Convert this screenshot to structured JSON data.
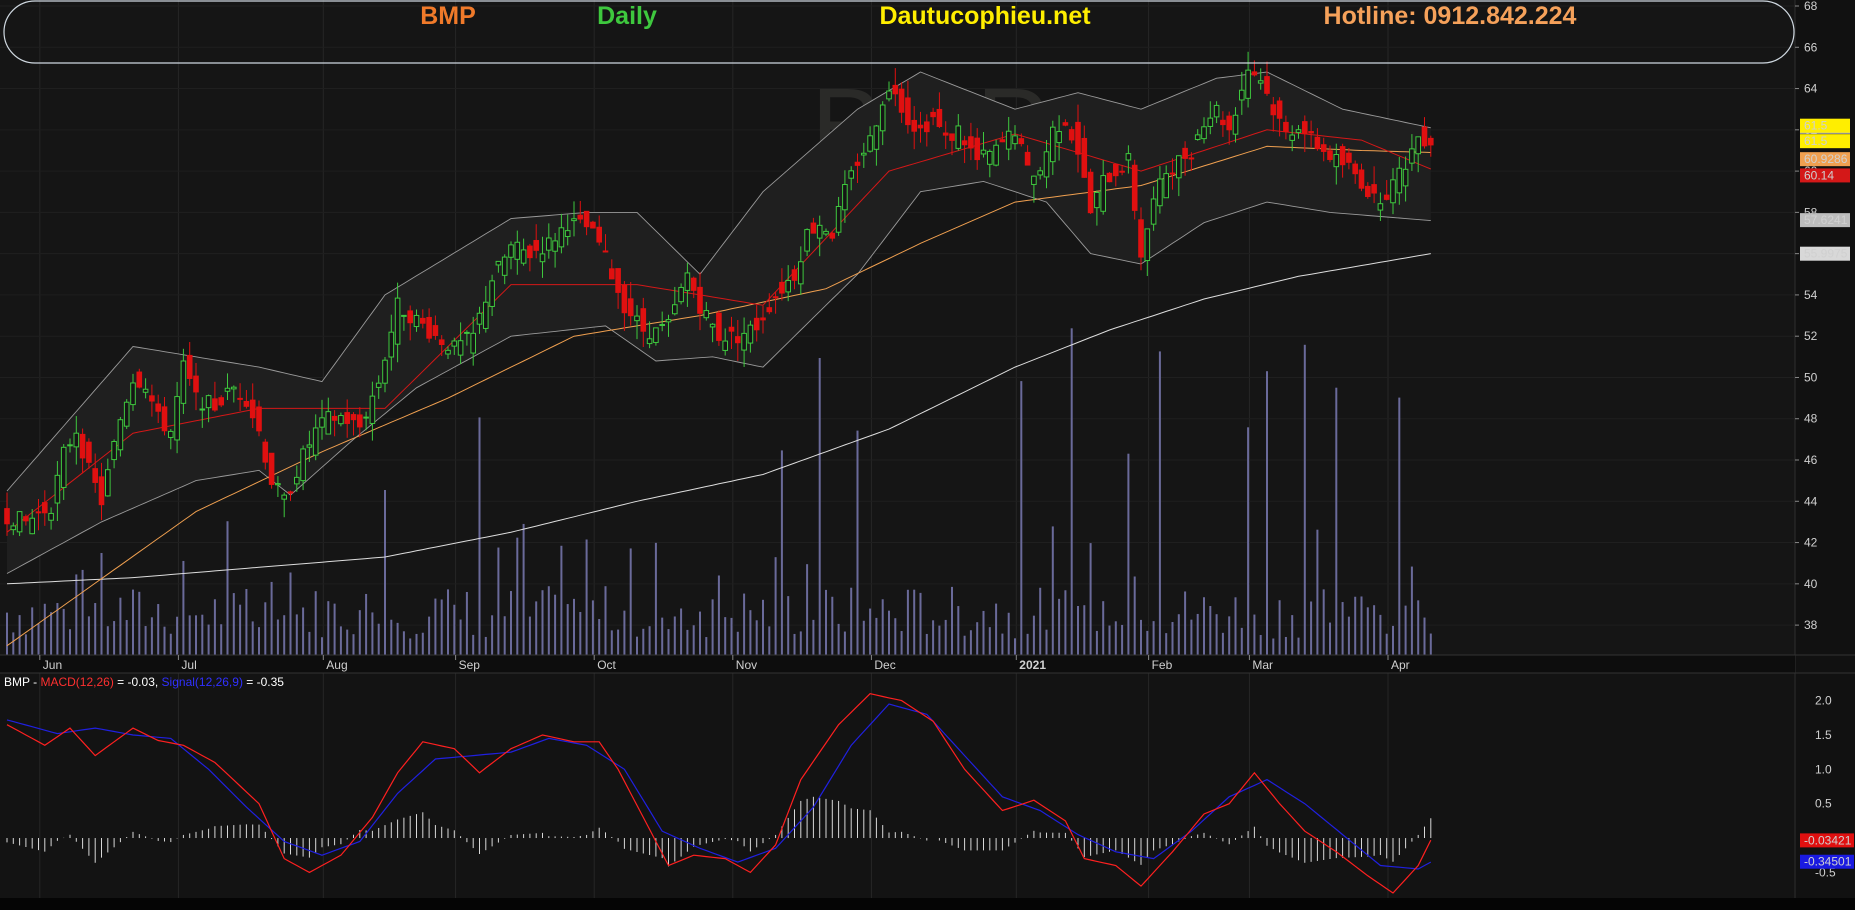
{
  "header": {
    "ticker": "BMP",
    "period": "Daily",
    "site": "Dautucophieu.net",
    "hotline": "Hotline: 0912.842.224",
    "watermark": "BMP"
  },
  "colors": {
    "background": "#151515",
    "up": "#3ec83e",
    "down": "#e01010",
    "ma_red": "#d41818",
    "ma_orange": "#f0a050",
    "ma_white": "#dddddd",
    "bands": "#9a9a9a",
    "volume": "#6a6a9a",
    "macd": "#ff2020",
    "signal": "#2020e0",
    "ticker_color": "#f07a2a",
    "period_color": "#3ec83e",
    "site_color": "#ffee00",
    "hotline_color": "#f5a15a"
  },
  "chart_data": {
    "type": "candlestick",
    "price_axis": {
      "ylim": [
        36.6,
        68
      ],
      "ticks": [
        "38",
        "40",
        "42",
        "44",
        "46",
        "48",
        "50",
        "52",
        "54",
        "56",
        "58",
        "60",
        "62",
        "64",
        "66",
        "68"
      ]
    },
    "x_labels": [
      {
        "label": "Jun",
        "bar": 6
      },
      {
        "label": "Jul",
        "bar": 28
      },
      {
        "label": "Aug",
        "bar": 51
      },
      {
        "label": "Sep",
        "bar": 72
      },
      {
        "label": "Oct",
        "bar": 94
      },
      {
        "label": "Nov",
        "bar": 116
      },
      {
        "label": "Dec",
        "bar": 138
      },
      {
        "label": "2021",
        "bar": 161
      },
      {
        "label": "Feb",
        "bar": 182
      },
      {
        "label": "Mar",
        "bar": 198
      },
      {
        "label": "Apr",
        "bar": 220
      }
    ],
    "price_anchors": [
      [
        0,
        43.3
      ],
      [
        3,
        43.0
      ],
      [
        7,
        43.8
      ],
      [
        9,
        46.3
      ],
      [
        11,
        47.5
      ],
      [
        13,
        45.5
      ],
      [
        15,
        44.0
      ],
      [
        18,
        48.0
      ],
      [
        20,
        50.0
      ],
      [
        22,
        49.7
      ],
      [
        24,
        48.0
      ],
      [
        26,
        47.4
      ],
      [
        28,
        50.5
      ],
      [
        30,
        49.0
      ],
      [
        33,
        48.6
      ],
      [
        36,
        49.5
      ],
      [
        38,
        49.0
      ],
      [
        40,
        47.4
      ],
      [
        42,
        45.0
      ],
      [
        44,
        44.0
      ],
      [
        47,
        46.2
      ],
      [
        49,
        47.4
      ],
      [
        51,
        48.0
      ],
      [
        53,
        48.1
      ],
      [
        56,
        47.6
      ],
      [
        59,
        49.8
      ],
      [
        62,
        53.5
      ],
      [
        65,
        52.8
      ],
      [
        68,
        52.0
      ],
      [
        71,
        51.4
      ],
      [
        74,
        52.0
      ],
      [
        77,
        54.8
      ],
      [
        80,
        56.3
      ],
      [
        83,
        56.0
      ],
      [
        86,
        56.5
      ],
      [
        89,
        57.5
      ],
      [
        92,
        57.3
      ],
      [
        94,
        56.5
      ],
      [
        96,
        55.0
      ],
      [
        98,
        53.5
      ],
      [
        101,
        52.3
      ],
      [
        103,
        52.2
      ],
      [
        105,
        52.5
      ],
      [
        108,
        55.0
      ],
      [
        110,
        53.5
      ],
      [
        113,
        52.0
      ],
      [
        116,
        52.0
      ],
      [
        119,
        52.5
      ],
      [
        122,
        54.0
      ],
      [
        125,
        55.0
      ],
      [
        127,
        57.0
      ],
      [
        129,
        57.5
      ],
      [
        131,
        57.0
      ],
      [
        133,
        59.0
      ],
      [
        135,
        60.5
      ],
      [
        137,
        61.5
      ],
      [
        139,
        63.5
      ],
      [
        141,
        64.0
      ],
      [
        143,
        62.5
      ],
      [
        145,
        62.0
      ],
      [
        147,
        62.6
      ],
      [
        149,
        61.5
      ],
      [
        151,
        62.0
      ],
      [
        154,
        60.5
      ],
      [
        157,
        61.0
      ],
      [
        160,
        62.0
      ],
      [
        162,
        60.0
      ],
      [
        164,
        60.0
      ],
      [
        166,
        62.0
      ],
      [
        168,
        62.5
      ],
      [
        170,
        61.0
      ],
      [
        172,
        58.0
      ],
      [
        174,
        59.5
      ],
      [
        176,
        60.0
      ],
      [
        178,
        60.5
      ],
      [
        180,
        56.0
      ],
      [
        182,
        58.5
      ],
      [
        184,
        60.0
      ],
      [
        186,
        60.5
      ],
      [
        188,
        61.0
      ],
      [
        190,
        62.5
      ],
      [
        192,
        63.0
      ],
      [
        194,
        62.0
      ],
      [
        197,
        65.0
      ],
      [
        199,
        64.5
      ],
      [
        201,
        63.0
      ],
      [
        203,
        61.8
      ],
      [
        205,
        62.3
      ],
      [
        207,
        61.5
      ],
      [
        209,
        61.0
      ],
      [
        211,
        60.5
      ],
      [
        213,
        60.2
      ],
      [
        215,
        59.5
      ],
      [
        217,
        58.6
      ],
      [
        219,
        59.0
      ],
      [
        221,
        59.8
      ],
      [
        223,
        61.0
      ],
      [
        224,
        61.7
      ],
      [
        226,
        61.5
      ]
    ],
    "ma20_anchors": [
      [
        0,
        42.5
      ],
      [
        20,
        47.3
      ],
      [
        40,
        48.5
      ],
      [
        60,
        48.5
      ],
      [
        80,
        54.5
      ],
      [
        100,
        54.5
      ],
      [
        120,
        53.5
      ],
      [
        140,
        60.0
      ],
      [
        160,
        61.8
      ],
      [
        180,
        60.0
      ],
      [
        200,
        62.0
      ],
      [
        215,
        61.5
      ],
      [
        226,
        60.1
      ]
    ],
    "ma50_anchors": [
      [
        0,
        37.0
      ],
      [
        30,
        43.5
      ],
      [
        50,
        46.4
      ],
      [
        70,
        49.0
      ],
      [
        90,
        52.0
      ],
      [
        110,
        53.0
      ],
      [
        130,
        54.3
      ],
      [
        145,
        56.5
      ],
      [
        160,
        58.5
      ],
      [
        180,
        59.3
      ],
      [
        200,
        61.2
      ],
      [
        215,
        61.0
      ],
      [
        226,
        60.9
      ]
    ],
    "ma200_anchors": [
      [
        0,
        40.0
      ],
      [
        20,
        40.3
      ],
      [
        40,
        40.8
      ],
      [
        60,
        41.3
      ],
      [
        80,
        42.5
      ],
      [
        100,
        44.0
      ],
      [
        120,
        45.3
      ],
      [
        140,
        47.5
      ],
      [
        160,
        50.5
      ],
      [
        175,
        52.3
      ],
      [
        190,
        53.8
      ],
      [
        205,
        54.9
      ],
      [
        226,
        56.0
      ]
    ],
    "band_upper_anchors": [
      [
        0,
        44.5
      ],
      [
        20,
        51.5
      ],
      [
        40,
        50.5
      ],
      [
        50,
        49.8
      ],
      [
        60,
        54.0
      ],
      [
        80,
        57.7
      ],
      [
        92,
        58.0
      ],
      [
        100,
        58.0
      ],
      [
        110,
        55.0
      ],
      [
        120,
        59.0
      ],
      [
        135,
        63.0
      ],
      [
        145,
        64.8
      ],
      [
        160,
        63.0
      ],
      [
        170,
        63.8
      ],
      [
        180,
        63.0
      ],
      [
        192,
        64.5
      ],
      [
        200,
        64.8
      ],
      [
        212,
        63.0
      ],
      [
        226,
        62.1
      ]
    ],
    "band_lower_anchors": [
      [
        0,
        40.5
      ],
      [
        15,
        43.0
      ],
      [
        30,
        45.0
      ],
      [
        40,
        45.5
      ],
      [
        45,
        44.3
      ],
      [
        55,
        47.0
      ],
      [
        65,
        49.5
      ],
      [
        80,
        52.0
      ],
      [
        95,
        52.5
      ],
      [
        103,
        50.8
      ],
      [
        112,
        51.0
      ],
      [
        120,
        50.5
      ],
      [
        135,
        55.0
      ],
      [
        145,
        59.0
      ],
      [
        155,
        59.5
      ],
      [
        165,
        58.5
      ],
      [
        172,
        56.0
      ],
      [
        180,
        55.5
      ],
      [
        190,
        57.5
      ],
      [
        200,
        58.5
      ],
      [
        210,
        58.0
      ],
      [
        226,
        57.6
      ]
    ],
    "volume_seed": 7,
    "spike_bars": [
      [
        38,
        0.2
      ],
      [
        45,
        0.25
      ],
      [
        60,
        0.5
      ],
      [
        75,
        0.72
      ],
      [
        92,
        0.35
      ],
      [
        123,
        0.62
      ],
      [
        129,
        0.9
      ],
      [
        135,
        0.68
      ],
      [
        161,
        0.83
      ],
      [
        169,
        0.99
      ],
      [
        178,
        0.61
      ],
      [
        183,
        0.92
      ],
      [
        197,
        0.69
      ],
      [
        200,
        0.86
      ],
      [
        206,
        0.94
      ],
      [
        211,
        0.81
      ],
      [
        221,
        0.78
      ]
    ],
    "last_values": {
      "band_upper": "62.1493",
      "close_1": "61.5",
      "close_2": "61.5",
      "ma50": "60.9286",
      "ma20": "60.14",
      "band_lower": "57.6241",
      "ma200": "55.9975"
    },
    "macd": {
      "label_ticker": "BMP",
      "label_macd": "MACD(12,26)",
      "label_macd_val": "= -0.03,",
      "label_signal": "Signal(12,26,9)",
      "label_signal_val": "= -0.35",
      "ylim": [
        -0.8,
        2.3
      ],
      "ticks": [
        "-0.5",
        "0.5",
        "1.0",
        "1.5",
        "2.0"
      ],
      "last_macd": "-0.03421",
      "last_signal": "-0.34501",
      "macd_anchors": [
        [
          0,
          1.65
        ],
        [
          6,
          1.35
        ],
        [
          10,
          1.6
        ],
        [
          14,
          1.2
        ],
        [
          20,
          1.6
        ],
        [
          24,
          1.42
        ],
        [
          28,
          1.35
        ],
        [
          33,
          1.1
        ],
        [
          40,
          0.5
        ],
        [
          44,
          -0.3
        ],
        [
          48,
          -0.5
        ],
        [
          53,
          -0.25
        ],
        [
          58,
          0.3
        ],
        [
          62,
          0.95
        ],
        [
          66,
          1.4
        ],
        [
          71,
          1.3
        ],
        [
          75,
          0.95
        ],
        [
          80,
          1.3
        ],
        [
          85,
          1.5
        ],
        [
          90,
          1.4
        ],
        [
          94,
          1.4
        ],
        [
          97,
          1.0
        ],
        [
          101,
          0.3
        ],
        [
          105,
          -0.4
        ],
        [
          109,
          -0.25
        ],
        [
          114,
          -0.3
        ],
        [
          118,
          -0.5
        ],
        [
          122,
          -0.1
        ],
        [
          126,
          0.85
        ],
        [
          132,
          1.65
        ],
        [
          137,
          2.1
        ],
        [
          142,
          2.0
        ],
        [
          147,
          1.7
        ],
        [
          152,
          1.0
        ],
        [
          158,
          0.4
        ],
        [
          163,
          0.55
        ],
        [
          168,
          0.25
        ],
        [
          171,
          -0.3
        ],
        [
          176,
          -0.4
        ],
        [
          180,
          -0.7
        ],
        [
          185,
          -0.2
        ],
        [
          190,
          0.35
        ],
        [
          194,
          0.5
        ],
        [
          198,
          0.95
        ],
        [
          202,
          0.5
        ],
        [
          206,
          0.1
        ],
        [
          211,
          -0.2
        ],
        [
          216,
          -0.55
        ],
        [
          220,
          -0.8
        ],
        [
          224,
          -0.4
        ],
        [
          226,
          -0.03
        ]
      ],
      "signal_anchors": [
        [
          0,
          1.72
        ],
        [
          8,
          1.52
        ],
        [
          14,
          1.6
        ],
        [
          20,
          1.5
        ],
        [
          26,
          1.45
        ],
        [
          32,
          1.0
        ],
        [
          38,
          0.45
        ],
        [
          44,
          -0.05
        ],
        [
          50,
          -0.25
        ],
        [
          56,
          -0.05
        ],
        [
          62,
          0.65
        ],
        [
          68,
          1.15
        ],
        [
          74,
          1.2
        ],
        [
          80,
          1.25
        ],
        [
          86,
          1.45
        ],
        [
          92,
          1.35
        ],
        [
          98,
          1.0
        ],
        [
          104,
          0.1
        ],
        [
          110,
          -0.15
        ],
        [
          116,
          -0.35
        ],
        [
          122,
          -0.15
        ],
        [
          128,
          0.45
        ],
        [
          134,
          1.35
        ],
        [
          140,
          1.95
        ],
        [
          146,
          1.8
        ],
        [
          152,
          1.2
        ],
        [
          158,
          0.6
        ],
        [
          164,
          0.4
        ],
        [
          170,
          0.05
        ],
        [
          176,
          -0.2
        ],
        [
          182,
          -0.3
        ],
        [
          188,
          0.1
        ],
        [
          194,
          0.6
        ],
        [
          200,
          0.85
        ],
        [
          206,
          0.5
        ],
        [
          212,
          0.05
        ],
        [
          218,
          -0.4
        ],
        [
          224,
          -0.45
        ],
        [
          226,
          -0.35
        ]
      ]
    }
  }
}
